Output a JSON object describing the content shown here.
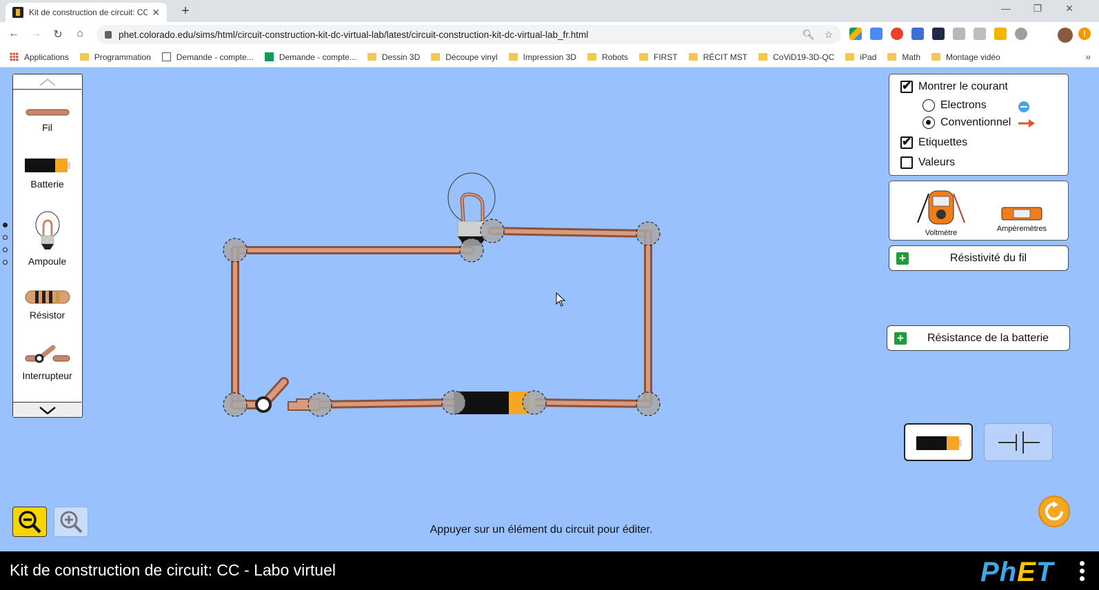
{
  "browser": {
    "tab_title": "Kit de construction de circuit: CC",
    "tab_close": "✕",
    "new_tab": "+",
    "url": "phet.colorado.edu/sims/html/circuit-construction-kit-dc-virtual-lab/latest/circuit-construction-kit-dc-virtual-lab_fr.html",
    "window_minimize": "—",
    "window_restore": "❐",
    "window_close": "✕",
    "nav_back": "←",
    "nav_forward": "→",
    "nav_reload": "↻",
    "nav_home": "⌂",
    "zoom_icon": "🔍︎",
    "star_icon": "☆",
    "menu_badge": "!"
  },
  "bookmarks": [
    {
      "label": "Applications",
      "icon": "apps-grid-icon"
    },
    {
      "label": "Programmation",
      "icon": "folder-icon"
    },
    {
      "label": "Demande - compte...",
      "icon": "doc-icon"
    },
    {
      "label": "Demande - compte...",
      "icon": "sheets-icon"
    },
    {
      "label": "Dessin 3D",
      "icon": "folder-icon"
    },
    {
      "label": "Découpe vinyl",
      "icon": "folder-icon"
    },
    {
      "label": "Impression 3D",
      "icon": "folder-icon"
    },
    {
      "label": "Robots",
      "icon": "folder-icon"
    },
    {
      "label": "FIRST",
      "icon": "folder-icon"
    },
    {
      "label": "RÉCIT MST",
      "icon": "folder-icon"
    },
    {
      "label": "CoViD19-3D-QC",
      "icon": "folder-icon"
    },
    {
      "label": "iPad",
      "icon": "folder-icon"
    },
    {
      "label": "Math",
      "icon": "folder-icon"
    },
    {
      "label": "Montage vidéo",
      "icon": "folder-icon"
    }
  ],
  "bookmarks_more": "»",
  "toolbox": {
    "items": [
      {
        "label": "Fil",
        "icon": "wire-icon"
      },
      {
        "label": "Batterie",
        "icon": "battery-icon"
      },
      {
        "label": "Ampoule",
        "icon": "lightbulb-icon"
      },
      {
        "label": "Résistor",
        "icon": "resistor-icon"
      },
      {
        "label": "Interrupteur",
        "icon": "switch-icon"
      }
    ]
  },
  "options": {
    "show_current": {
      "label": "Montrer le courant",
      "checked": true
    },
    "electrons": {
      "label": "Electrons",
      "selected": false
    },
    "conventional": {
      "label": "Conventionnel",
      "selected": true
    },
    "labels": {
      "label": "Etiquettes",
      "checked": true
    },
    "values": {
      "label": "Valeurs",
      "checked": false
    }
  },
  "sensors": {
    "voltmeter": "Voltmètre",
    "ammeter": "Ampèremètres"
  },
  "wire_resistivity": {
    "label": "Résistivité du fil",
    "plus": "+"
  },
  "battery_resistance": {
    "label": "Résistance de la batterie",
    "plus": "+"
  },
  "hint": "Appuyer sur un élément du circuit pour éditer.",
  "sim_title": "Kit de construction de circuit: CC - Labo virtuel",
  "phet_logo": {
    "p": "P",
    "h": "h",
    "e": "E",
    "t": "T"
  },
  "colors": {
    "background": "#99c1fe",
    "wire": "#c8866a",
    "accent_green": "#1e9e3a",
    "reset_orange": "#f5a623"
  }
}
